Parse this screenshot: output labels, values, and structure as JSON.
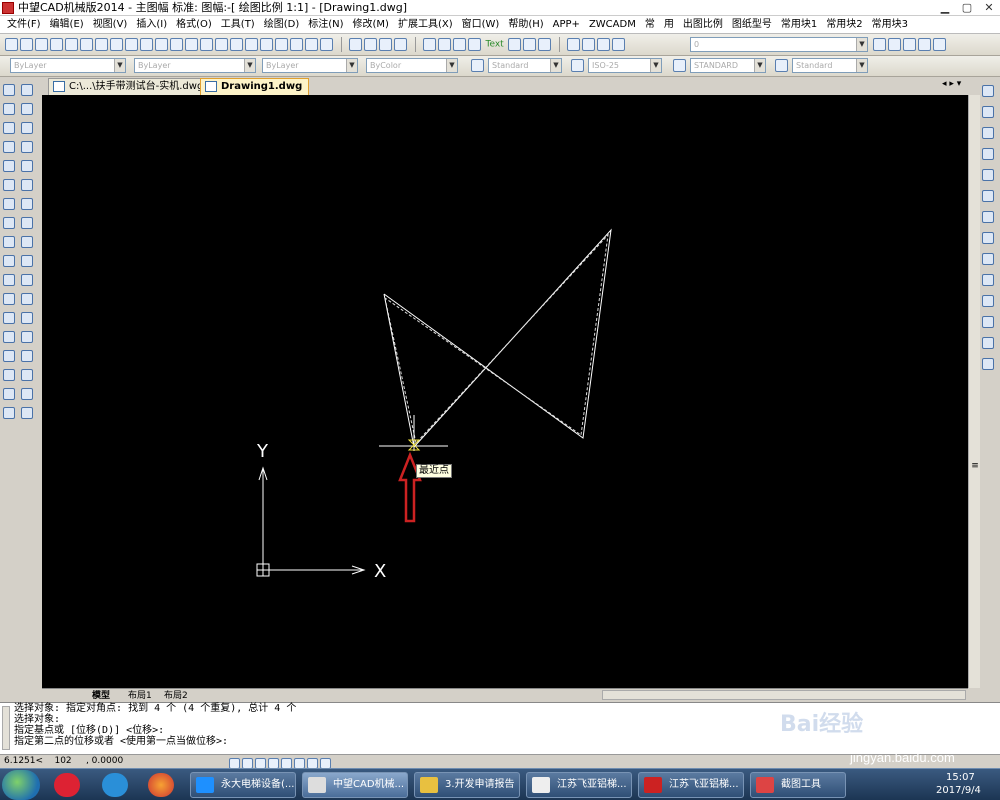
{
  "window": {
    "title": "中望CAD机械版2014 - 主图幅  标准: 图幅:-[ 绘图比例 1:1] - [Drawing1.dwg]"
  },
  "menu": [
    "文件(F)",
    "编辑(E)",
    "视图(V)",
    "插入(I)",
    "格式(O)",
    "工具(T)",
    "绘图(D)",
    "标注(N)",
    "修改(M)",
    "扩展工具(X)",
    "窗口(W)",
    "帮助(H)",
    "APP+",
    "ZWCADM",
    "常",
    "用",
    "出图比例",
    "图纸型号",
    "常用块1",
    "常用块2",
    "常用块3"
  ],
  "properties": {
    "layer": "ByLayer",
    "linetype": "ByLayer",
    "lineweight": "ByLayer",
    "color": "ByColor",
    "text_style": "Standard",
    "dim_style": "ISO-25",
    "table_style": "STANDARD",
    "multileader_style": "Standard",
    "layer_state": "0"
  },
  "toolbar": {
    "text_tool": "Text"
  },
  "tabs": [
    {
      "label": "C:\\...\\扶手带测试台-实机.dwg"
    },
    {
      "label": "Drawing1.dwg"
    }
  ],
  "canvas": {
    "snap_tooltip": "最近点",
    "axis_x": "X",
    "axis_y": "Y",
    "colors": {
      "background": "#000000",
      "lines": "#ffffff",
      "arrow": "#cc2222",
      "tooltip_bg": "#ffffe1"
    }
  },
  "layout_tabs": [
    "模型",
    "布局1",
    "布局2"
  ],
  "command": {
    "lines": [
      "选择对象: 指定对角点: 找到 4 个 (4 个重复), 总计 4 个",
      "选择对象:",
      "指定基点或 [位移(D)] <位移>:",
      "指定第二点的位移或者 <使用第一点当做位移>:"
    ]
  },
  "status": {
    "coords": "6.1251<    102     , 0.0000"
  },
  "taskbar": {
    "items": [
      "永大电梯设备(...",
      "中望CAD机械...",
      "3.开发申请报告",
      "江苏飞亚铝梯...",
      "江苏飞亚铝梯...",
      "截图工具"
    ],
    "time": "15:07",
    "date": "2017/9/4"
  },
  "watermark": {
    "brand": "Bai经验",
    "url": "jingyan.baidu.com"
  }
}
